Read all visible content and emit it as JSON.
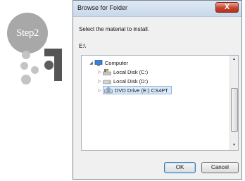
{
  "step_badge": {
    "label": "Step2"
  },
  "dialog": {
    "title": "Browse for Folder",
    "close_glyph": "X",
    "instruction": "Select the material to install.",
    "current_path": "E:\\",
    "tree": [
      {
        "label": "Computer",
        "icon": "computer-icon",
        "expanded": true
      },
      {
        "label": "Local Disk (C:)",
        "icon": "windows-drive-icon"
      },
      {
        "label": "Local Disk (D:)",
        "icon": "hard-drive-icon"
      },
      {
        "label": "DVD Drive (E:) CS4PT",
        "icon": "dvd-drive-icon",
        "selected": true
      }
    ],
    "ok_label": "OK",
    "cancel_label": "Cancel"
  }
}
